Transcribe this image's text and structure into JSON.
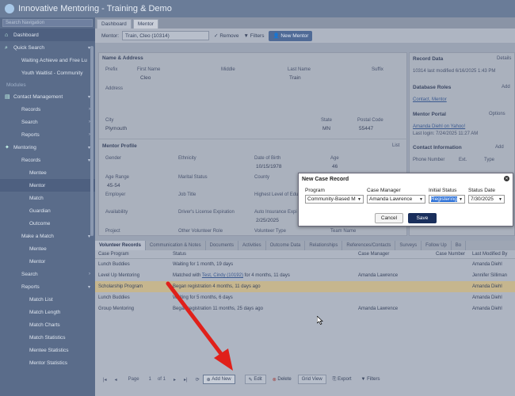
{
  "app": {
    "title": "Innovative Mentoring - Training & Demo"
  },
  "sidebar": {
    "search_placeholder": "Search Navigation",
    "items": [
      {
        "label": "Dashboard",
        "icon": "home-icon"
      },
      {
        "label": "Quick Search",
        "icon": "search-icon"
      },
      {
        "label": "Waiting Achieve and Free Lu"
      },
      {
        "label": "Youth Waitlist - Community"
      },
      {
        "label": "Modules"
      },
      {
        "label": "Contact Management",
        "icon": "contacts-icon"
      },
      {
        "label": "Records"
      },
      {
        "label": "Search"
      },
      {
        "label": "Reports"
      },
      {
        "label": "Mentoring",
        "icon": "mentoring-icon"
      },
      {
        "label": "Records"
      },
      {
        "label": "Mentee"
      },
      {
        "label": "Mentor"
      },
      {
        "label": "Match"
      },
      {
        "label": "Guardian"
      },
      {
        "label": "Outcome"
      },
      {
        "label": "Make a Match"
      },
      {
        "label": "Mentee"
      },
      {
        "label": "Mentor"
      },
      {
        "label": "Search"
      },
      {
        "label": "Reports"
      },
      {
        "label": "Match List"
      },
      {
        "label": "Match Length"
      },
      {
        "label": "Match Charts"
      },
      {
        "label": "Match Statistics"
      },
      {
        "label": "Mentee Statistics"
      },
      {
        "label": "Mentor Statistics"
      }
    ]
  },
  "tabs": {
    "dashboard": "Dashboard",
    "mentor": "Mentor"
  },
  "toolbar": {
    "mentor_label": "Mentor:",
    "mentor_value": "Train, Cleo (10314)",
    "remove": "Remove",
    "filters": "Filters",
    "new_mentor": "New Mentor"
  },
  "form": {
    "name_address": "Name & Address",
    "prefix": "Prefix",
    "first_name": "First Name",
    "first_name_value": "Cleo",
    "middle": "Middle",
    "last_name": "Last Name",
    "last_name_value": "Train",
    "suffix": "Suffix",
    "address": "Address",
    "city": "City",
    "city_value": "Plymouth",
    "state": "State",
    "state_value": "MN",
    "postal": "Postal Code",
    "postal_value": "55447",
    "mentor_profile": "Mentor Profile",
    "list": "List",
    "gender": "Gender",
    "ethnicity": "Ethnicity",
    "dob": "Date of Birth",
    "dob_value": "10/15/1978",
    "age": "Age",
    "age_value": "46",
    "age_range": "Age Range",
    "age_range_value": "45-54",
    "marital": "Marital Status",
    "county": "County",
    "employer": "Employer",
    "job_title": "Job Title",
    "education": "Highest Level of Edu",
    "availability": "Availability",
    "license": "Driver's License Expiration",
    "auto": "Auto Insurance Expi",
    "auto_value": "2/25/2025",
    "project": "Project",
    "other_role": "Other Volunteer Role",
    "vol_type": "Volunteer Type",
    "team": "Team Name"
  },
  "right": {
    "record_data": "Record Data",
    "details": "Details",
    "record_text": "10314 last modified 6/16/2025 1:43 PM",
    "db_roles": "Database Roles",
    "add": "Add",
    "roles_link": "Contact, Mentor",
    "portal": "Mentor Portal",
    "options": "Options",
    "portal_link": "Amanda Diehl on Yahoo!",
    "last_login": "Last login: 7/24/2025 11:27 AM",
    "contact_info": "Contact Information",
    "add2": "Add",
    "phone": "Phone Number",
    "ext": "Ext.",
    "type": "Type"
  },
  "bottom": {
    "tabs": [
      "Volunteer Records",
      "Communication & Notes",
      "Documents",
      "Activities",
      "Outcome Data",
      "Relationships",
      "References/Contacts",
      "Surveys",
      "Follow Up",
      "Bo"
    ],
    "columns": [
      "Case Program",
      "Status",
      "Case Manager",
      "Case Number",
      "Last Modified By"
    ],
    "rows": [
      {
        "program": "Lunch Buddies",
        "status": "Waiting for 1 month, 19 days",
        "manager": "",
        "number": "",
        "modified": "Amanda Diehl"
      },
      {
        "program": "Level Up Mentoring",
        "status_pre": "Matched with ",
        "status_link": "Test, Cindy (10192)",
        "status_post": " for 4 months, 11 days",
        "manager": "Amanda Lawrence",
        "number": "",
        "modified": "Jennifer Silliman"
      },
      {
        "program": "Scholarship Program",
        "status": "Began registration 4 months, 11 days ago",
        "manager": "",
        "number": "",
        "modified": "Amanda Diehl"
      },
      {
        "program": "Lunch Buddies",
        "status": "Waiting for 5 months, 6 days",
        "manager": "",
        "number": "",
        "modified": "Amanda Diehl"
      },
      {
        "program": "Group Mentoring",
        "status": "Began registration 11 months, 25 days ago",
        "manager": "Amanda Lawrence",
        "number": "",
        "modified": "Amanda Diehl"
      }
    ],
    "pager": {
      "page_label": "Page",
      "page_value": "1",
      "of": "of 1",
      "add_new": "Add New",
      "edit": "Edit",
      "delete": "Delete",
      "grid_view": "Grid View",
      "export": "Export",
      "filters": "Filters"
    }
  },
  "modal": {
    "title": "New Case Record",
    "program_label": "Program",
    "program_value": "Community-Based M",
    "manager_label": "Case Manager",
    "manager_value": "Amanda Lawrence",
    "status_label": "Initial Status",
    "status_value": "Registering",
    "date_label": "Status Date",
    "date_value": "7/30/2025",
    "cancel": "Cancel",
    "save": "Save"
  },
  "colors": {
    "sidebar": "#5a6c8a",
    "save_button": "#1a2f5c",
    "arrow": "#e0201a",
    "highlight_row": "#c6b68e"
  }
}
